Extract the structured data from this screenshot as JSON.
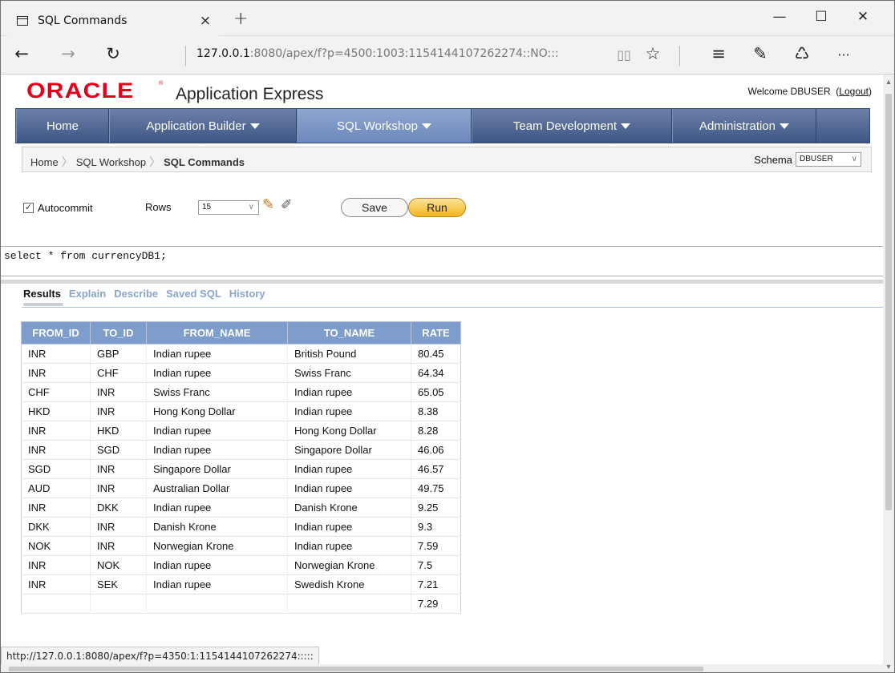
{
  "browser": {
    "tab_title": "SQL Commands",
    "tab_close": "×",
    "new_tab": "+",
    "window_controls": {
      "minimize": "—",
      "maximize": "☐",
      "close": "✕"
    },
    "nav": {
      "back": "←",
      "forward": "→",
      "refresh": "↻"
    },
    "url_host": "127.0.0.1",
    "url_rest": ":8080/apex/f?p=4500:1003:1154144107262274::NO:::",
    "toolbar_icons": {
      "reading_view": "▯▯",
      "favorite": "☆",
      "hub": "≡",
      "notes": "✎",
      "share": "♺",
      "more": "···"
    }
  },
  "apex": {
    "oracle_logo": "ORACLE",
    "registered": "®",
    "product_name": "Application Express",
    "welcome_text": "Welcome DBUSER",
    "logout_label": "Logout"
  },
  "main_nav": [
    {
      "label": "Home",
      "dropdown": false,
      "active": false
    },
    {
      "label": "Application Builder",
      "dropdown": true,
      "active": false
    },
    {
      "label": "SQL Workshop",
      "dropdown": true,
      "active": true
    },
    {
      "label": "Team Development",
      "dropdown": true,
      "active": false
    },
    {
      "label": "Administration",
      "dropdown": true,
      "active": false
    }
  ],
  "breadcrumb": {
    "home": "Home",
    "sql_workshop": "SQL Workshop",
    "current": "SQL Commands",
    "separator": "〉"
  },
  "schema": {
    "label": "Schema",
    "value": "DBUSER"
  },
  "toolbar": {
    "autocommit_label": "Autocommit",
    "autocommit_checked": true,
    "rows_label": "Rows",
    "rows_value": "15",
    "save_label": "Save",
    "run_label": "Run"
  },
  "editor": {
    "sql": "select * from currencyDB1;"
  },
  "result_tabs": [
    {
      "label": "Results",
      "active": true
    },
    {
      "label": "Explain",
      "active": false
    },
    {
      "label": "Describe",
      "active": false
    },
    {
      "label": "Saved SQL",
      "active": false
    },
    {
      "label": "History",
      "active": false
    }
  ],
  "results": {
    "columns": [
      "FROM_ID",
      "TO_ID",
      "FROM_NAME",
      "TO_NAME",
      "RATE"
    ],
    "rows": [
      [
        "INR",
        "GBP",
        "Indian rupee",
        "British Pound",
        "80.45"
      ],
      [
        "INR",
        "CHF",
        "Indian rupee",
        "Swiss Franc",
        "64.34"
      ],
      [
        "CHF",
        "INR",
        "Swiss Franc",
        "Indian rupee",
        "65.05"
      ],
      [
        "HKD",
        "INR",
        "Hong Kong Dollar",
        "Indian rupee",
        "8.38"
      ],
      [
        "INR",
        "HKD",
        "Indian rupee",
        "Hong Kong Dollar",
        "8.28"
      ],
      [
        "INR",
        "SGD",
        "Indian rupee",
        "Singapore Dollar",
        "46.06"
      ],
      [
        "SGD",
        "INR",
        "Singapore Dollar",
        "Indian rupee",
        "46.57"
      ],
      [
        "AUD",
        "INR",
        "Australian Dollar",
        "Indian rupee",
        "49.75"
      ],
      [
        "INR",
        "DKK",
        "Indian rupee",
        "Danish Krone",
        "9.25"
      ],
      [
        "DKK",
        "INR",
        "Danish Krone",
        "Indian rupee",
        "9.3"
      ],
      [
        "NOK",
        "INR",
        "Norwegian Krone",
        "Indian rupee",
        "7.59"
      ],
      [
        "INR",
        "NOK",
        "Indian rupee",
        "Norwegian Krone",
        "7.5"
      ],
      [
        "INR",
        "SEK",
        "Indian rupee",
        "Swedish Krone",
        "7.21"
      ],
      [
        "",
        "",
        "",
        "",
        "7.29"
      ]
    ]
  },
  "status_bar": {
    "link_url": "http://127.0.0.1:8080/apex/f?p=4350:1:1154144107262274:::::"
  }
}
